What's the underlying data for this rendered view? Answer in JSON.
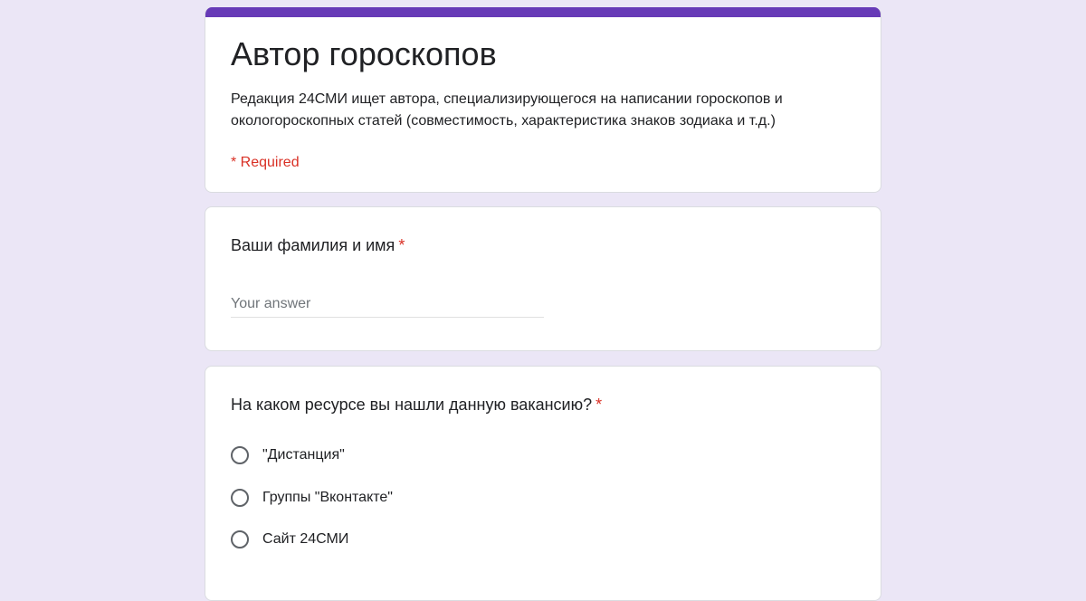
{
  "form": {
    "title": "Автор гороскопов",
    "description": "Редакция 24СМИ ищет автора, специализирующегося на написании гороскопов и окологороскопных статей (совместимость, характеристика знаков зодиака и т.д.)",
    "required_note": "* Required",
    "accent_color": "#673ab7",
    "background_color": "#ebe6f6"
  },
  "questions": [
    {
      "title": "Ваши фамилия и имя",
      "required_mark": "*",
      "type": "short-answer",
      "value": "",
      "placeholder": "Your answer"
    },
    {
      "title": "На каком ресурсе вы нашли данную вакансию?",
      "required_mark": "*",
      "type": "multiple-choice",
      "options": [
        {
          "label": "\"Дистанция\"",
          "selected": false
        },
        {
          "label": "Группы \"Вконтакте\"",
          "selected": false
        },
        {
          "label": "Сайт 24СМИ",
          "selected": false
        }
      ]
    }
  ]
}
